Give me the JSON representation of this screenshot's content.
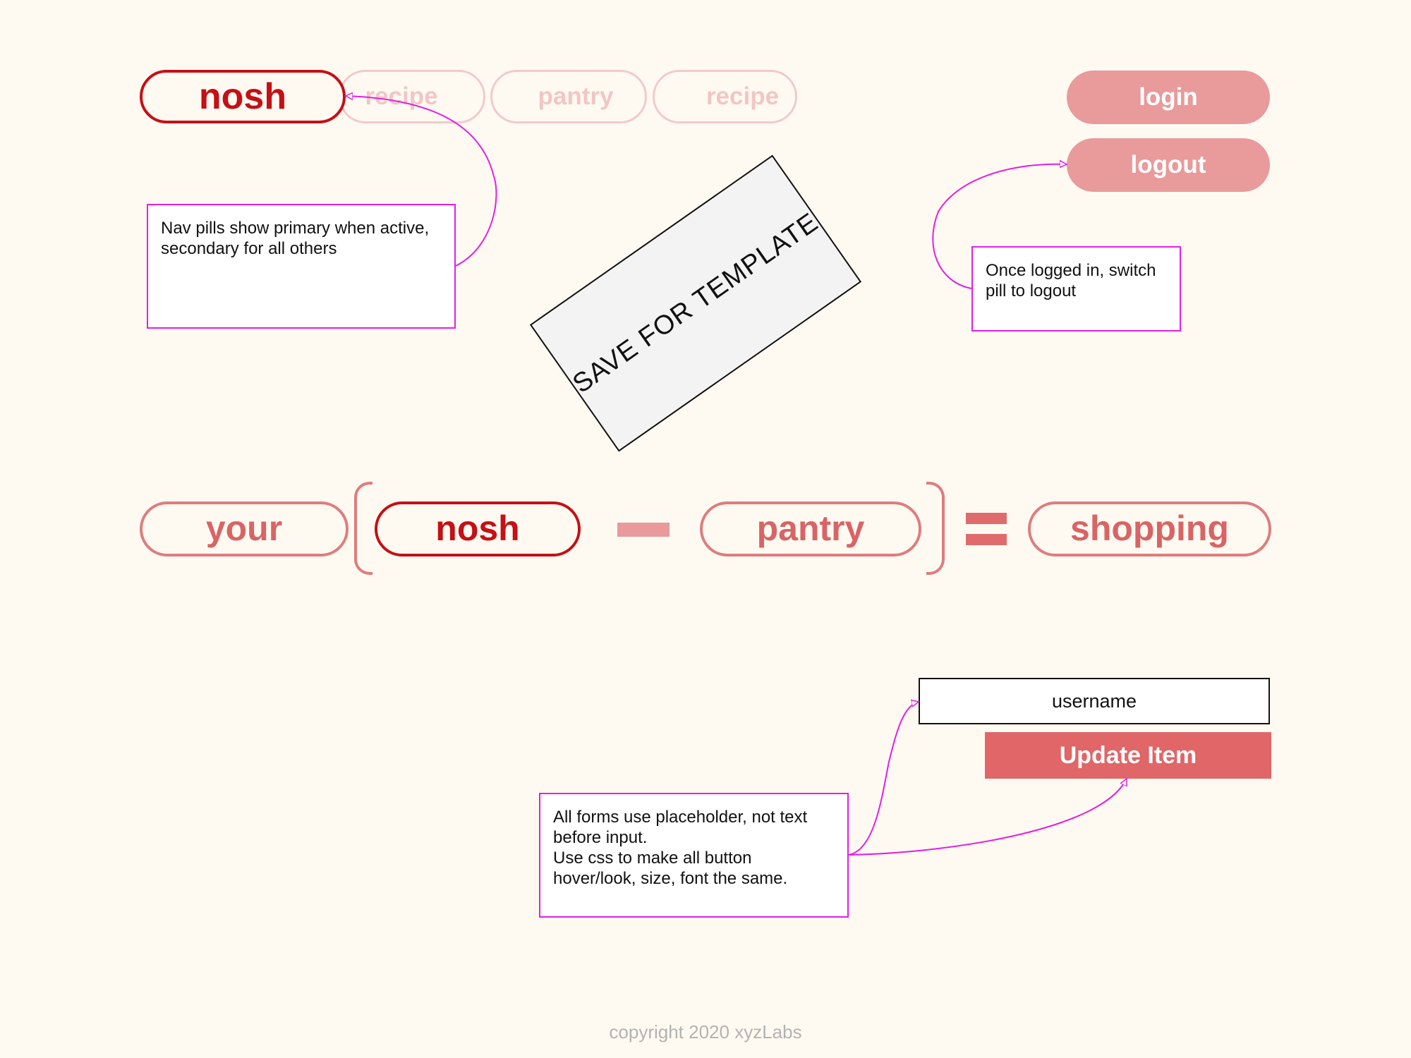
{
  "nav": {
    "brand": "nosh",
    "items": [
      "recipe",
      "pantry",
      "recipe"
    ]
  },
  "auth": {
    "login": "login",
    "logout": "logout"
  },
  "notes": {
    "nav_pills": [
      "Nav pills show primary when active,",
      "secondary for all others"
    ],
    "logout": [
      "Once logged in, switch",
      "pill to logout"
    ],
    "forms": [
      "All forms use placeholder, not text",
      "before input.",
      "Use css to make all button",
      "hover/look, size, font the same."
    ]
  },
  "stamp": "SAVE FOR TEMPLATE",
  "equation": {
    "your": "your",
    "nosh": "nosh",
    "pantry": "pantry",
    "shopping": "shopping"
  },
  "form": {
    "username_placeholder": "username",
    "update_button": "Update Item"
  },
  "footer": "copyright 2020 xyzLabs",
  "colors": {
    "background": "#fffaf1",
    "primary": "#c41016",
    "secondary": "#de7d7e",
    "muted": "#f2c6c6",
    "annotation": "#e21ee8",
    "button": "#e06668"
  }
}
